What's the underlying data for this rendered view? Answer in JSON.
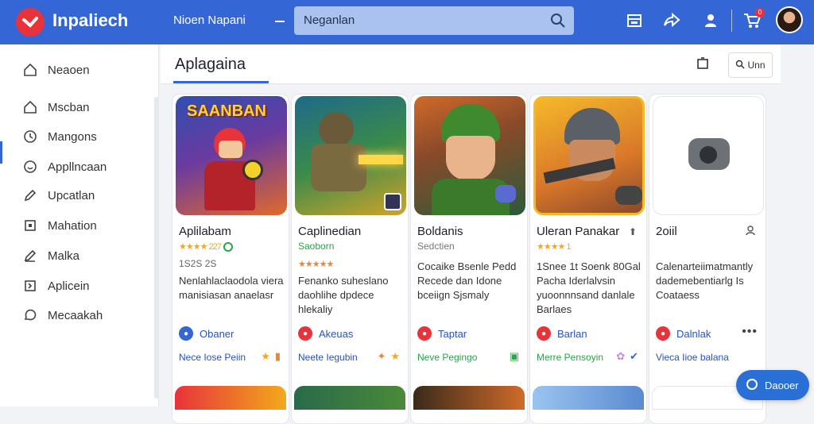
{
  "header": {
    "brand": "Inpaliech",
    "nav_title": "Nioen Napani",
    "search_placeholder": "Neganlan",
    "cart_count": "0"
  },
  "sidebar": {
    "items": [
      {
        "label": "Neaoen",
        "icon": "home-outline-icon"
      },
      {
        "label": "Mscban",
        "icon": "home-icon"
      },
      {
        "label": "Mangons",
        "icon": "clock-icon"
      },
      {
        "label": "Appllncaan",
        "icon": "smile-icon"
      },
      {
        "label": "Upcatlan",
        "icon": "pencil-icon"
      },
      {
        "label": "Mahation",
        "icon": "box-icon"
      },
      {
        "label": "Malka",
        "icon": "edit-icon"
      },
      {
        "label": "Aplicein",
        "icon": "square-arrow-icon"
      },
      {
        "label": "Mecaakah",
        "icon": "chat-icon"
      }
    ]
  },
  "main": {
    "title": "Aplagaina",
    "filter_button": "Unn"
  },
  "cards": [
    {
      "thumb_text": "SAANBAN",
      "title": "Aplilabam",
      "sub": "★★★★ 227",
      "sub_color": "#f2a91c",
      "meta": "1S2S 2S",
      "desc": "Nenlahlaclaodola viera manisiasan anaelasr",
      "publisher": "Obaner",
      "pub_color": "#3566d6",
      "action": "Nece Iose Peiin",
      "action_color": "#2a52b8"
    },
    {
      "thumb_text": "",
      "title": "Caplinedian",
      "sub": "Saoborn",
      "sub_color": "#2aa34a",
      "meta": "★★★★★",
      "desc": "Fenanko suheslano daohlihe dpdece hlekaliy",
      "publisher": "Akeuas",
      "pub_color": "#e8333b",
      "action": "Neete Iegubin",
      "action_color": "#2a52b8"
    },
    {
      "thumb_text": "",
      "title": "Boldanis",
      "sub": "Sedctien",
      "sub_color": "#777",
      "meta": "",
      "desc": "Cocaike Bsenle Pedd Recede dan Idone bceiign Sjsmaly",
      "publisher": "Taptar",
      "pub_color": "#e8333b",
      "action": "Neve Pegingo",
      "action_color": "#2aa34a"
    },
    {
      "thumb_text": "",
      "title": "Uleran Panakar",
      "sub": "★★★★ 1",
      "sub_color": "#f2a91c",
      "meta": "",
      "desc": "1Snee 1t Soenk 80Gal Pacha Iderlalvsin yuoonnnsand danlale Barlaes",
      "publisher": "Barlan",
      "pub_color": "#e8333b",
      "action": "Merre Pensoyin",
      "action_color": "#2aa34a"
    },
    {
      "thumb_text": "",
      "title": "2oiil",
      "sub": "",
      "sub_color": "#777",
      "meta": "",
      "desc": "Calenarteiimatmantly dademebentiarlg Is Coataess",
      "publisher": "Dalnlak",
      "pub_color": "#e8333b",
      "action": "Vieca Iioe balana",
      "action_color": "#2a52b8"
    }
  ],
  "help": {
    "label": "Daooer"
  }
}
